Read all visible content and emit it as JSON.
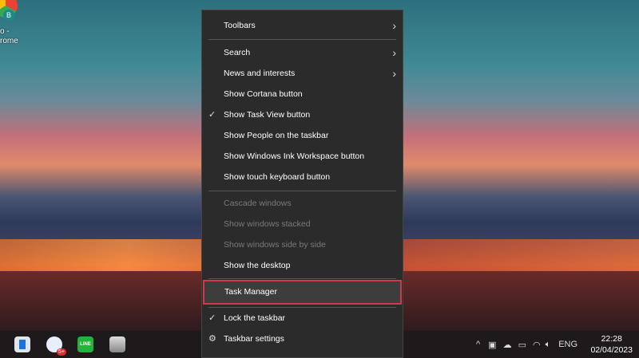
{
  "desktop": {
    "icon_label": "o -\nrome",
    "icon_badge": "B"
  },
  "menu": {
    "items": [
      {
        "label": "Toolbars",
        "submenu": true
      },
      {
        "label": "Search",
        "submenu": true
      },
      {
        "label": "News and interests",
        "submenu": true
      },
      {
        "label": "Show Cortana button"
      },
      {
        "label": "Show Task View button",
        "checked": true
      },
      {
        "label": "Show People on the taskbar"
      },
      {
        "label": "Show Windows Ink Workspace button"
      },
      {
        "label": "Show touch keyboard button"
      },
      {
        "label": "Cascade windows",
        "disabled": true
      },
      {
        "label": "Show windows stacked",
        "disabled": true
      },
      {
        "label": "Show windows side by side",
        "disabled": true
      },
      {
        "label": "Show the desktop"
      },
      {
        "label": "Task Manager",
        "highlighted": true
      },
      {
        "label": "Lock the taskbar",
        "checked": true
      },
      {
        "label": "Taskbar settings"
      }
    ]
  },
  "taskbar": {
    "zalo_badge": "5+",
    "line_label": "LINE",
    "language": "ENG",
    "time": "22:28",
    "date": "02/04/2023"
  },
  "colors": {
    "highlight_border": "#d6354a",
    "menu_bg": "#2b2b2b"
  }
}
